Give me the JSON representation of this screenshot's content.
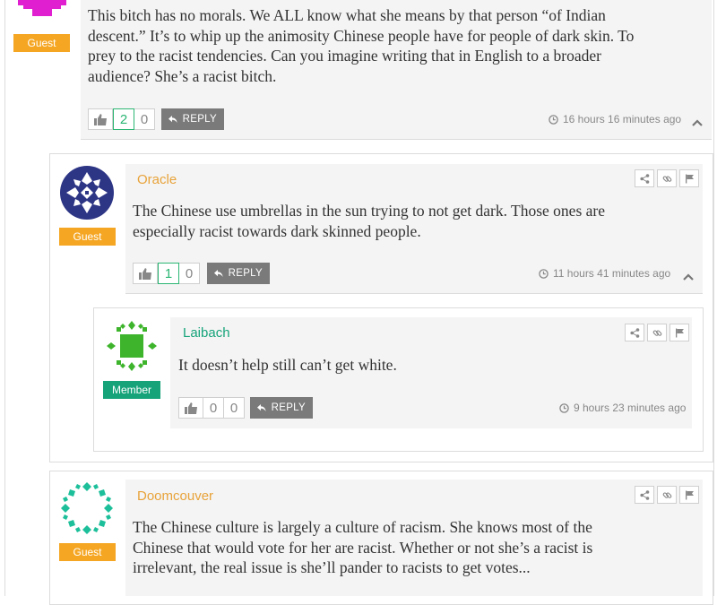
{
  "comments": [
    {
      "author": "",
      "badge": "Guest",
      "text_lines": [
        "This bitch has no morals. We ALL know what she means by that person “of Indian",
        "descent.” It’s to whip up the animosity Chinese people have for people of dark skin. To",
        "prey to the racist tendencies. Can you imagine writing that in English to a broader",
        "audience? She’s a racist bitch."
      ],
      "likes": "2",
      "dislikes": "0",
      "reply_label": "REPLY",
      "time": "16 hours 16 minutes ago"
    },
    {
      "author": "Oracle",
      "badge": "Guest",
      "text_lines": [
        "The Chinese use umbrellas in the sun trying to not get dark. Those ones are",
        "especially racist towards dark skinned people."
      ],
      "likes": "1",
      "dislikes": "0",
      "reply_label": "REPLY",
      "time": "11 hours 41 minutes ago"
    },
    {
      "author": "Laibach",
      "badge": "Member",
      "text_lines": [
        "It doesn’t help still can’t get white."
      ],
      "likes": "0",
      "dislikes": "0",
      "reply_label": "REPLY",
      "time": "9 hours 23 minutes ago"
    },
    {
      "author": "Doomcouver",
      "badge": "Guest",
      "text_lines": [
        "The Chinese culture is largely a culture of racism. She knows most of the",
        "Chinese that would vote for her are racist. Whether or not she’s a racist is",
        "irrelevant, the real issue is she’ll pander to racists to get votes..."
      ]
    }
  ],
  "colors": {
    "guest_badge": "#f5a623",
    "member_badge": "#16a37a",
    "author_guest": "#e8a33a",
    "author_member": "#16a37a",
    "panel_bg": "#f4f4f4",
    "reply_bg": "#7a7a7a"
  },
  "icons": [
    "thumbs-up-icon",
    "reply-arrow-icon",
    "clock-icon",
    "chevron-up-icon",
    "share-icon",
    "link-icon",
    "flag-icon"
  ]
}
